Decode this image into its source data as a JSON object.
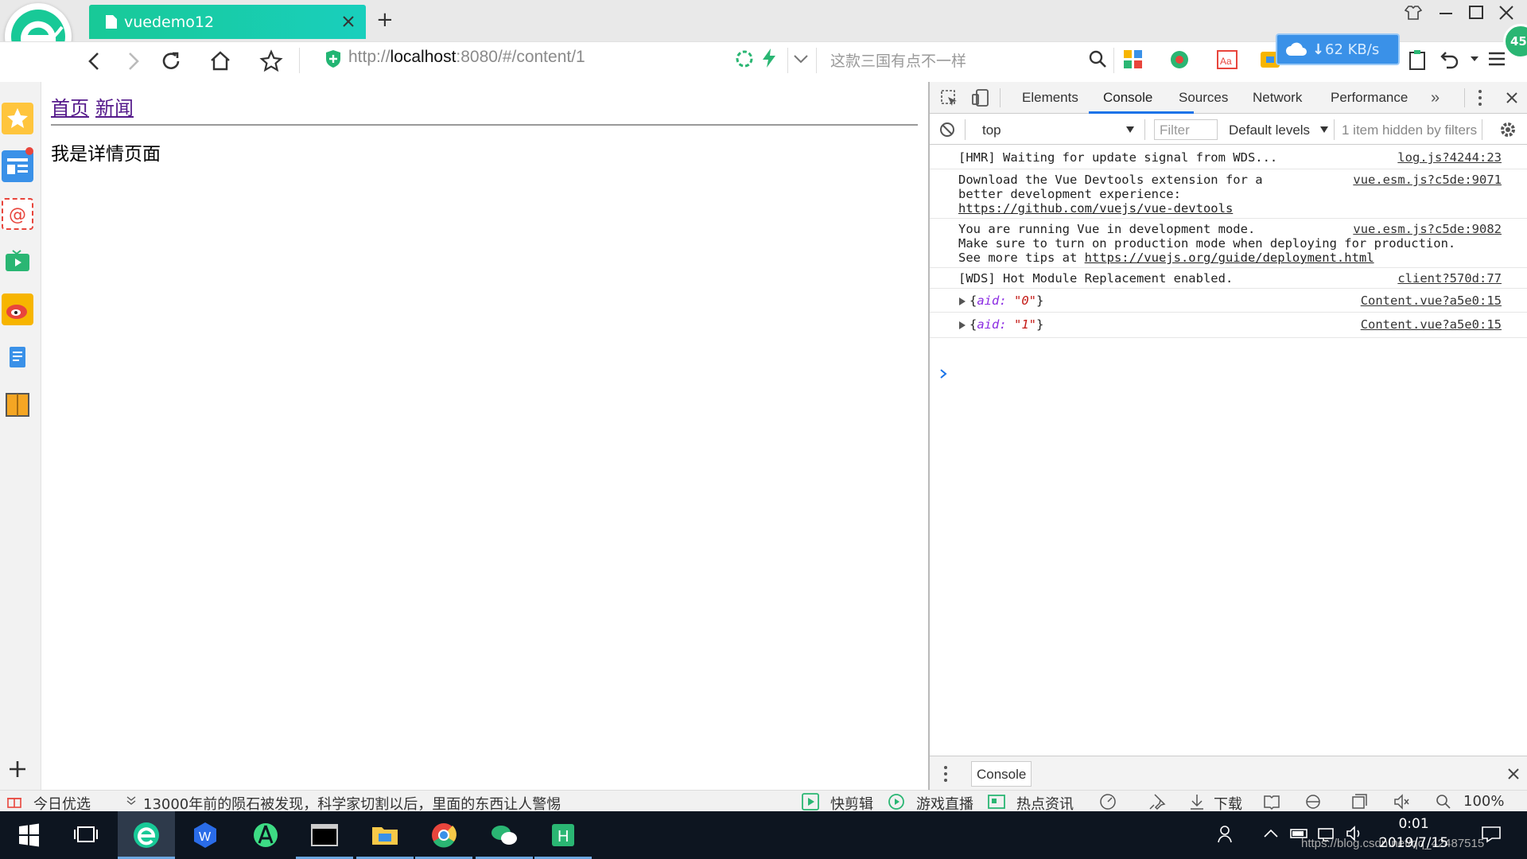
{
  "browser": {
    "tab_title": "vuedemo12",
    "url_prefix": "http://",
    "url_host": "localhost",
    "url_rest": ":8080/#/content/1",
    "search_placeholder": "这款三国有点不一样",
    "speed": "62 KB/s",
    "badge": "45"
  },
  "page": {
    "nav_links": [
      "首页",
      "新闻"
    ],
    "detail_text": "我是详情页面"
  },
  "devtools": {
    "tabs": [
      "Elements",
      "Console",
      "Sources",
      "Network",
      "Performance"
    ],
    "active_tab": "Console",
    "context": "top",
    "filter_placeholder": "Filter",
    "levels": "Default levels",
    "hidden": "1 item hidden by filters",
    "messages": [
      {
        "lines": [
          "[HMR] Waiting for update signal from WDS..."
        ],
        "source": "log.js?4244:23"
      },
      {
        "lines": [
          "Download the Vue Devtools extension for a",
          "better development experience:"
        ],
        "link": "https://github.com/vuejs/vue-devtools",
        "source": "vue.esm.js?c5de:9071"
      },
      {
        "lines": [
          "You are running Vue in development mode.",
          "Make sure to turn on production mode when deploying for production."
        ],
        "tail_prefix": "See more tips at ",
        "link": "https://vuejs.org/guide/deployment.html",
        "source": "vue.esm.js?c5de:9082"
      },
      {
        "lines": [
          "[WDS] Hot Module Replacement enabled."
        ],
        "source": "client?570d:77"
      }
    ],
    "objects": [
      {
        "key": "aid",
        "value": "\"0\"",
        "source": "Content.vue?a5e0:15"
      },
      {
        "key": "aid",
        "value": "\"1\"",
        "source": "Content.vue?a5e0:15"
      }
    ],
    "drawer_tab": "Console"
  },
  "statusbar": {
    "today": "今日优选",
    "headline": "13000年前的陨石被发现，科学家切割以后，里面的东西让人警惕",
    "kuaijianji": "快剪辑",
    "live": "游戏直播",
    "news": "热点资讯",
    "download": "下载",
    "zoom": "100%"
  },
  "taskbar": {
    "time": "0:01",
    "date": "2019/7/15",
    "watermark": "https://blog.csdn.net/qq_42487515"
  },
  "colors": {
    "tab_green": "#18c997",
    "link_purple": "#551a8b",
    "devtools_blue": "#1a73e8"
  }
}
